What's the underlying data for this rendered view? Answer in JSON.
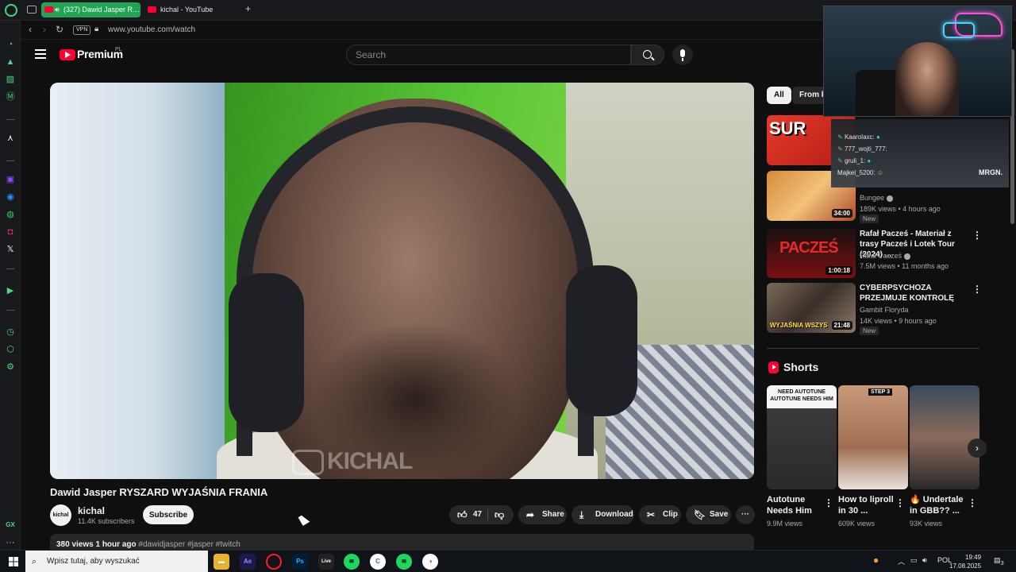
{
  "browser": {
    "tabs": [
      {
        "label": "(327) Dawid Jasper R…"
      },
      {
        "label": "kichal - YouTube"
      }
    ],
    "new_tab_glyph": "+",
    "vpn_label": "VPN",
    "url": "www.youtube.com/watch"
  },
  "header": {
    "brand": "Premium",
    "region": "PL",
    "search_placeholder": "Search"
  },
  "video": {
    "watermark": "KICHAL",
    "title": "Dawid Jasper RYSZARD WYJAŚNIA FRANIA",
    "channel": {
      "name": "kichal",
      "avatar_text": "kichal",
      "subscribers": "11.4K subscribers"
    },
    "subscribe_label": "Subscribe",
    "actions": {
      "likes": "47",
      "share": "Share",
      "download": "Download",
      "clip": "Clip",
      "save": "Save",
      "more": "···"
    },
    "description": {
      "meta": "380 views  1 hour ago",
      "tags": "#dawidjasper #jasper #twitch"
    }
  },
  "sidebar": {
    "chips": [
      {
        "label": "All"
      },
      {
        "label": "From ki"
      }
    ],
    "recommendations": [
      {
        "thumb_text": "SUR",
        "duration": ""
      },
      {
        "duration": "34:00",
        "channel": "Bungee",
        "views": "189K views • 4 hours ago",
        "badge": "New"
      },
      {
        "thumb_text": "PACZEŚ",
        "duration": "1:00:18",
        "title": "Rafał Pacześ - Materiał z trasy Pacześ i Lotek Tour (2024) ...",
        "channel": "Rafał Pacześ",
        "views": "7.5M views • 11 months ago"
      },
      {
        "thumb_text": "WYJAŚNIA WSZYS",
        "duration": "21:48",
        "title": "CYBERPSYCHOZA PRZEJMUJE KONTROLĘ",
        "channel": "Gambit Floryda",
        "views": "14K views • 9 hours ago",
        "badge": "New"
      }
    ],
    "shorts_heading": "Shorts",
    "shorts": [
      {
        "thumb_text": "NEED AUTOTUNE AUTOTUNE NEEDS HIM",
        "title": "Autotune Needs Him",
        "views": "9.9M views"
      },
      {
        "thumb_text": "STEP 3",
        "title": "How to liproll in 30 ...",
        "views": "609K views"
      },
      {
        "thumb_text": "",
        "title": "🔥 Undertale in GBB?? ...",
        "views": "93K views"
      }
    ]
  },
  "stream_chat": {
    "messages": [
      {
        "user": "Kaarolaxc:"
      },
      {
        "user": "777_wojti_777:"
      },
      {
        "user": "gruli_1:"
      },
      {
        "user": "Majkel_5200:"
      }
    ],
    "logo": "MRGN."
  },
  "taskbar": {
    "search_placeholder": "Wpisz tutaj, aby wyszukać",
    "apps": [
      {
        "label": "Ae"
      },
      {
        "label": "Ps"
      },
      {
        "label": "Live"
      }
    ],
    "language": "POL",
    "time": "19:49",
    "date": "17.08.2025",
    "notifications": "3"
  },
  "colors": {
    "youtube_red": "#ff0033",
    "opera_green": "#23a455",
    "background": "#0f0f0f"
  }
}
